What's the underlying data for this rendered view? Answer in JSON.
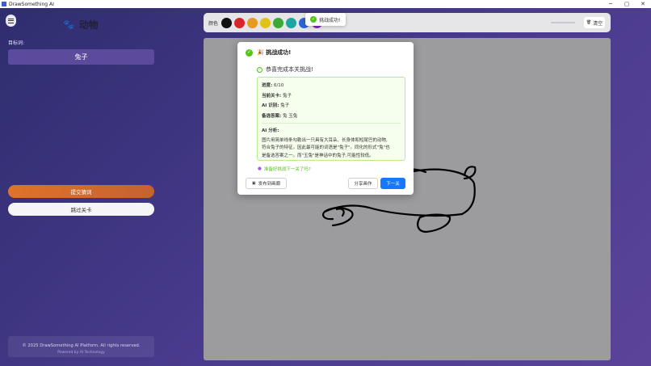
{
  "window": {
    "title": "DrawSomething AI",
    "minimize_glyph": "─",
    "maximize_glyph": "▢",
    "close_glyph": "✕"
  },
  "sidebar": {
    "category_icon": "paw-icon",
    "category_glyph": "🐾",
    "category_title": "动物",
    "target_label": "目标词:",
    "target_word": "兔子",
    "submit_label": "提交猜词",
    "skip_label": "跳过关卡",
    "footer_copyright": "© 2025 DrawSomething AI Platform. All rights reserved.",
    "footer_powered": "Powered by AI Technology"
  },
  "toolbar": {
    "color_label": "颜色",
    "colors": [
      "#111111",
      "#d9262b",
      "#e69a20",
      "#e0c21a",
      "#3aa935",
      "#1fa5a0",
      "#2a67d6",
      "#7a2fb8"
    ],
    "clear_label": "清空",
    "clear_icon": "trash-icon",
    "clear_glyph": "🗑"
  },
  "toast": {
    "icon": "check-circle-icon",
    "text": "挑战成功!"
  },
  "dialog": {
    "title": "🎉 挑战成功!",
    "subtitle": "恭喜完成本关挑战!",
    "progress_key": "进度:",
    "progress_value": "6/10",
    "level_key": "当前关卡:",
    "level_value": "兔子",
    "ai_key": "AI 识别:",
    "ai_value": "兔子",
    "alt_key": "备选答案:",
    "alt_value": "兔 玉兔",
    "analysis_key": "AI 分析:",
    "analysis_lines": [
      "图片用简单线条勾勒出一只具有大耳朵、长身体和短尾巴的动物,",
      "符合兔子的特征。因此最可能的词语是\"兔子\"。同化的形式\"兔\"也",
      "是备选答案之一。而\"玉兔\"是神话中的兔子,可能性较低。"
    ],
    "ready_text": "准备好挑战下一关了吗?",
    "publish_label": "发布到画廊",
    "publish_icon": "image-icon",
    "share_label": "分享画作",
    "next_label": "下一关"
  }
}
